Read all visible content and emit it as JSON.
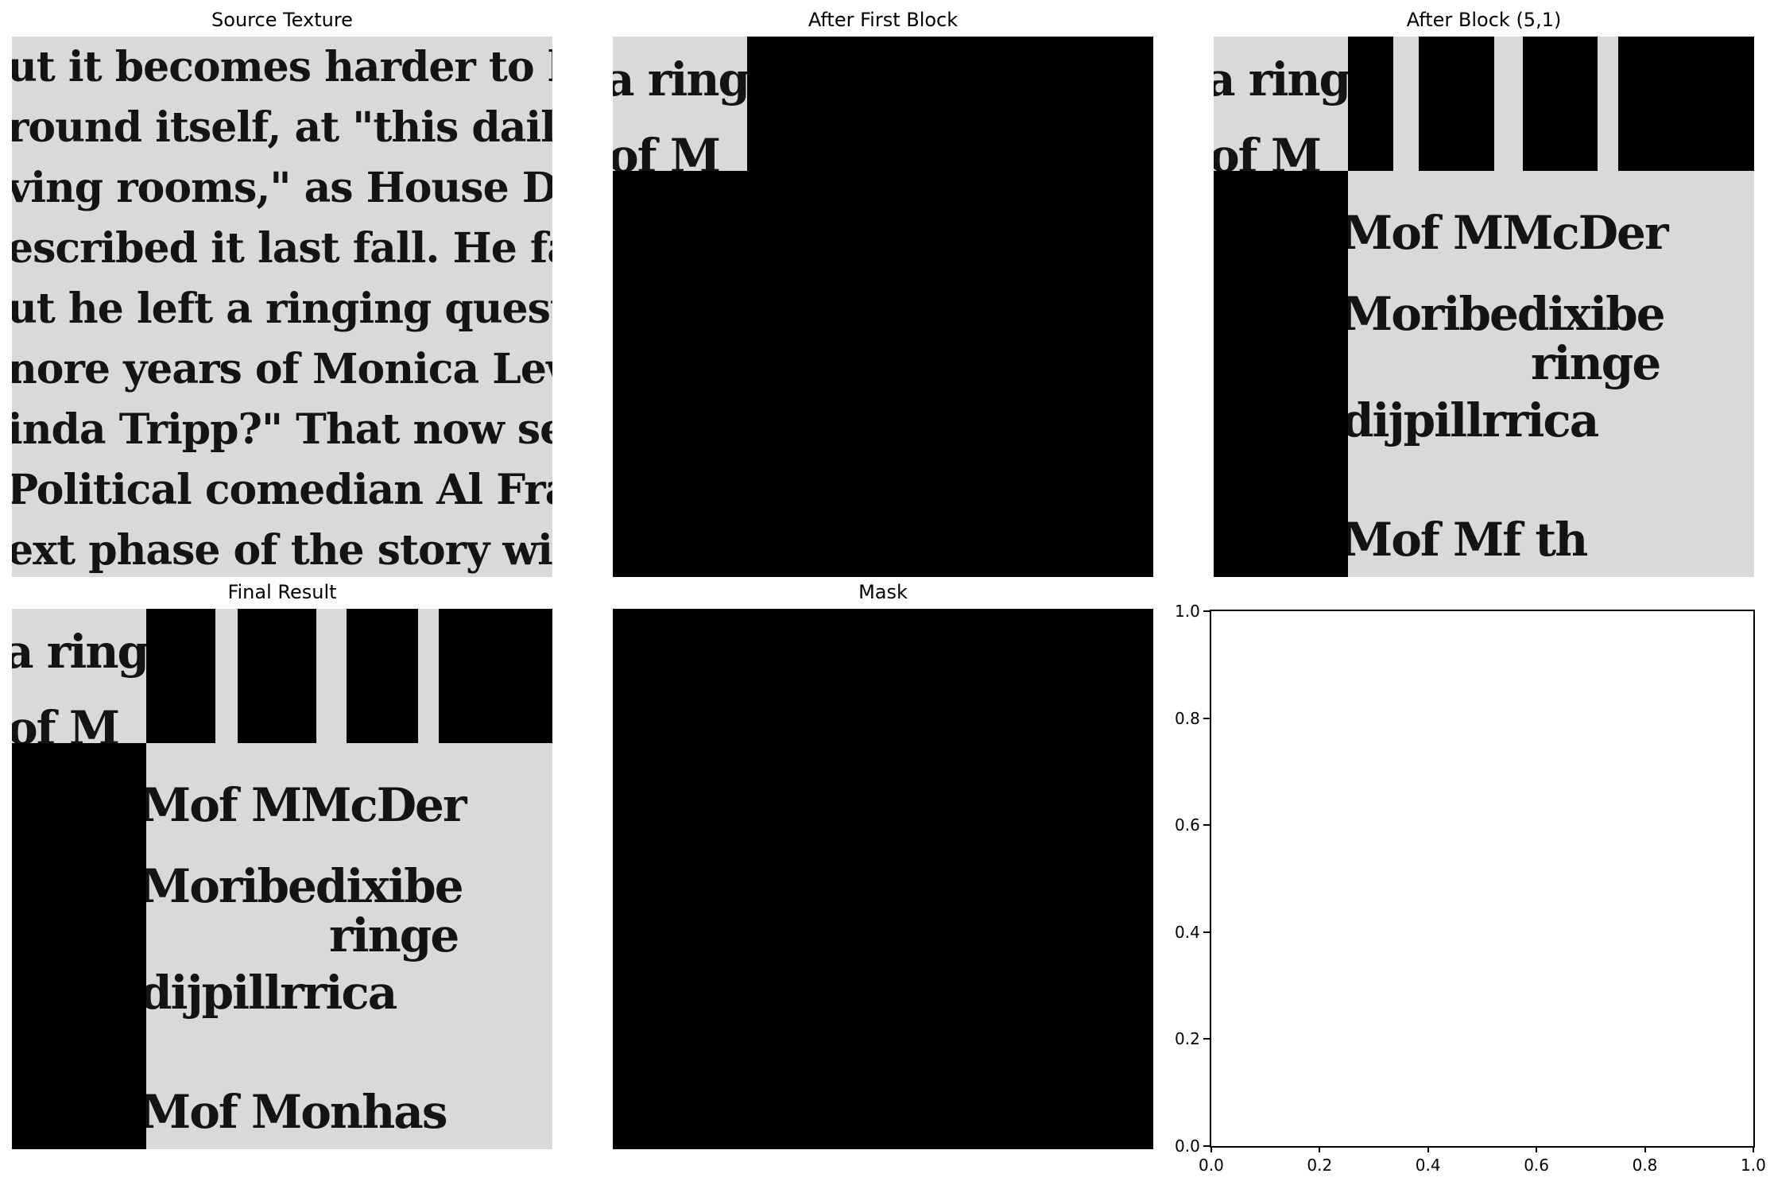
{
  "panels": {
    "source": {
      "title": "Source Texture"
    },
    "first_block": {
      "title": "After First Block"
    },
    "block_51": {
      "title": "After Block (5,1)"
    },
    "final": {
      "title": "Final Result"
    },
    "mask": {
      "title": "Mask"
    }
  },
  "source_lines": [
    "ut it becomes harder to lau",
    "round itself, at \"this daily r",
    "ving rooms,\" as House Der",
    "escribed it last fall. He fai",
    "ut he left a ringing questio",
    "nore years of Monica Lewin",
    "inda Tripp?\" That now seen",
    "Political comedian Al Fran",
    "ext phase of the story will"
  ],
  "fragments": {
    "corner_top": "a ring",
    "corner_bottom": "of M",
    "row2": "Mof MMcDer",
    "row3": "Moribedixibe",
    "row3b": "ringe",
    "row4": "dijpillrrica",
    "row5_block": "Mof Mf th",
    "row5_final": "Mof Monhas"
  },
  "empty_axes": {
    "x_ticks": [
      "0.0",
      "0.2",
      "0.4",
      "0.6",
      "0.8",
      "1.0"
    ],
    "y_ticks": [
      "0.0",
      "0.2",
      "0.4",
      "0.6",
      "0.8",
      "1.0"
    ]
  }
}
